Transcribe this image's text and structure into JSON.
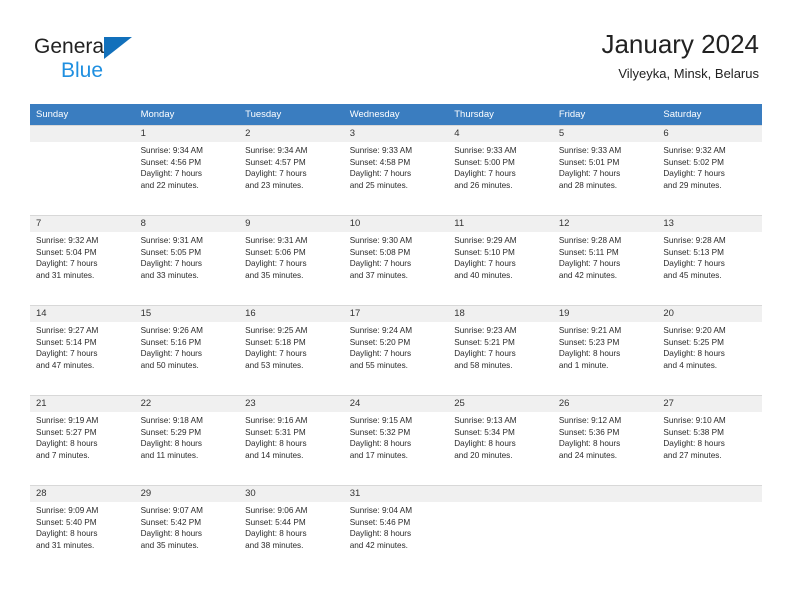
{
  "brand": {
    "name_part1": "General",
    "name_part2": "Blue",
    "triangle_icon": "triangle-logo-icon",
    "accent_dark_blue": "#1270bb",
    "accent_light_blue": "#1f8fe0"
  },
  "header": {
    "title": "January 2024",
    "subtitle": "Vilyeyka, Minsk, Belarus"
  },
  "theme": {
    "header_row_bg": "#3a7dc0",
    "header_row_text": "#ffffff",
    "daynum_bg": "#f0f0f0",
    "cell_border": "#d8d8d8",
    "body_text": "#2b2b2b"
  },
  "weekday_headers": [
    "Sunday",
    "Monday",
    "Tuesday",
    "Wednesday",
    "Thursday",
    "Friday",
    "Saturday"
  ],
  "weeks": [
    [
      {
        "day": "",
        "empty": true,
        "sunrise": "",
        "sunset": "",
        "daylight_line1": "",
        "daylight_line2": ""
      },
      {
        "day": "1",
        "empty": false,
        "sunrise": "Sunrise: 9:34 AM",
        "sunset": "Sunset: 4:56 PM",
        "daylight_line1": "Daylight: 7 hours",
        "daylight_line2": "and 22 minutes."
      },
      {
        "day": "2",
        "empty": false,
        "sunrise": "Sunrise: 9:34 AM",
        "sunset": "Sunset: 4:57 PM",
        "daylight_line1": "Daylight: 7 hours",
        "daylight_line2": "and 23 minutes."
      },
      {
        "day": "3",
        "empty": false,
        "sunrise": "Sunrise: 9:33 AM",
        "sunset": "Sunset: 4:58 PM",
        "daylight_line1": "Daylight: 7 hours",
        "daylight_line2": "and 25 minutes."
      },
      {
        "day": "4",
        "empty": false,
        "sunrise": "Sunrise: 9:33 AM",
        "sunset": "Sunset: 5:00 PM",
        "daylight_line1": "Daylight: 7 hours",
        "daylight_line2": "and 26 minutes."
      },
      {
        "day": "5",
        "empty": false,
        "sunrise": "Sunrise: 9:33 AM",
        "sunset": "Sunset: 5:01 PM",
        "daylight_line1": "Daylight: 7 hours",
        "daylight_line2": "and 28 minutes."
      },
      {
        "day": "6",
        "empty": false,
        "sunrise": "Sunrise: 9:32 AM",
        "sunset": "Sunset: 5:02 PM",
        "daylight_line1": "Daylight: 7 hours",
        "daylight_line2": "and 29 minutes."
      }
    ],
    [
      {
        "day": "7",
        "empty": false,
        "sunrise": "Sunrise: 9:32 AM",
        "sunset": "Sunset: 5:04 PM",
        "daylight_line1": "Daylight: 7 hours",
        "daylight_line2": "and 31 minutes."
      },
      {
        "day": "8",
        "empty": false,
        "sunrise": "Sunrise: 9:31 AM",
        "sunset": "Sunset: 5:05 PM",
        "daylight_line1": "Daylight: 7 hours",
        "daylight_line2": "and 33 minutes."
      },
      {
        "day": "9",
        "empty": false,
        "sunrise": "Sunrise: 9:31 AM",
        "sunset": "Sunset: 5:06 PM",
        "daylight_line1": "Daylight: 7 hours",
        "daylight_line2": "and 35 minutes."
      },
      {
        "day": "10",
        "empty": false,
        "sunrise": "Sunrise: 9:30 AM",
        "sunset": "Sunset: 5:08 PM",
        "daylight_line1": "Daylight: 7 hours",
        "daylight_line2": "and 37 minutes."
      },
      {
        "day": "11",
        "empty": false,
        "sunrise": "Sunrise: 9:29 AM",
        "sunset": "Sunset: 5:10 PM",
        "daylight_line1": "Daylight: 7 hours",
        "daylight_line2": "and 40 minutes."
      },
      {
        "day": "12",
        "empty": false,
        "sunrise": "Sunrise: 9:28 AM",
        "sunset": "Sunset: 5:11 PM",
        "daylight_line1": "Daylight: 7 hours",
        "daylight_line2": "and 42 minutes."
      },
      {
        "day": "13",
        "empty": false,
        "sunrise": "Sunrise: 9:28 AM",
        "sunset": "Sunset: 5:13 PM",
        "daylight_line1": "Daylight: 7 hours",
        "daylight_line2": "and 45 minutes."
      }
    ],
    [
      {
        "day": "14",
        "empty": false,
        "sunrise": "Sunrise: 9:27 AM",
        "sunset": "Sunset: 5:14 PM",
        "daylight_line1": "Daylight: 7 hours",
        "daylight_line2": "and 47 minutes."
      },
      {
        "day": "15",
        "empty": false,
        "sunrise": "Sunrise: 9:26 AM",
        "sunset": "Sunset: 5:16 PM",
        "daylight_line1": "Daylight: 7 hours",
        "daylight_line2": "and 50 minutes."
      },
      {
        "day": "16",
        "empty": false,
        "sunrise": "Sunrise: 9:25 AM",
        "sunset": "Sunset: 5:18 PM",
        "daylight_line1": "Daylight: 7 hours",
        "daylight_line2": "and 53 minutes."
      },
      {
        "day": "17",
        "empty": false,
        "sunrise": "Sunrise: 9:24 AM",
        "sunset": "Sunset: 5:20 PM",
        "daylight_line1": "Daylight: 7 hours",
        "daylight_line2": "and 55 minutes."
      },
      {
        "day": "18",
        "empty": false,
        "sunrise": "Sunrise: 9:23 AM",
        "sunset": "Sunset: 5:21 PM",
        "daylight_line1": "Daylight: 7 hours",
        "daylight_line2": "and 58 minutes."
      },
      {
        "day": "19",
        "empty": false,
        "sunrise": "Sunrise: 9:21 AM",
        "sunset": "Sunset: 5:23 PM",
        "daylight_line1": "Daylight: 8 hours",
        "daylight_line2": "and 1 minute."
      },
      {
        "day": "20",
        "empty": false,
        "sunrise": "Sunrise: 9:20 AM",
        "sunset": "Sunset: 5:25 PM",
        "daylight_line1": "Daylight: 8 hours",
        "daylight_line2": "and 4 minutes."
      }
    ],
    [
      {
        "day": "21",
        "empty": false,
        "sunrise": "Sunrise: 9:19 AM",
        "sunset": "Sunset: 5:27 PM",
        "daylight_line1": "Daylight: 8 hours",
        "daylight_line2": "and 7 minutes."
      },
      {
        "day": "22",
        "empty": false,
        "sunrise": "Sunrise: 9:18 AM",
        "sunset": "Sunset: 5:29 PM",
        "daylight_line1": "Daylight: 8 hours",
        "daylight_line2": "and 11 minutes."
      },
      {
        "day": "23",
        "empty": false,
        "sunrise": "Sunrise: 9:16 AM",
        "sunset": "Sunset: 5:31 PM",
        "daylight_line1": "Daylight: 8 hours",
        "daylight_line2": "and 14 minutes."
      },
      {
        "day": "24",
        "empty": false,
        "sunrise": "Sunrise: 9:15 AM",
        "sunset": "Sunset: 5:32 PM",
        "daylight_line1": "Daylight: 8 hours",
        "daylight_line2": "and 17 minutes."
      },
      {
        "day": "25",
        "empty": false,
        "sunrise": "Sunrise: 9:13 AM",
        "sunset": "Sunset: 5:34 PM",
        "daylight_line1": "Daylight: 8 hours",
        "daylight_line2": "and 20 minutes."
      },
      {
        "day": "26",
        "empty": false,
        "sunrise": "Sunrise: 9:12 AM",
        "sunset": "Sunset: 5:36 PM",
        "daylight_line1": "Daylight: 8 hours",
        "daylight_line2": "and 24 minutes."
      },
      {
        "day": "27",
        "empty": false,
        "sunrise": "Sunrise: 9:10 AM",
        "sunset": "Sunset: 5:38 PM",
        "daylight_line1": "Daylight: 8 hours",
        "daylight_line2": "and 27 minutes."
      }
    ],
    [
      {
        "day": "28",
        "empty": false,
        "sunrise": "Sunrise: 9:09 AM",
        "sunset": "Sunset: 5:40 PM",
        "daylight_line1": "Daylight: 8 hours",
        "daylight_line2": "and 31 minutes."
      },
      {
        "day": "29",
        "empty": false,
        "sunrise": "Sunrise: 9:07 AM",
        "sunset": "Sunset: 5:42 PM",
        "daylight_line1": "Daylight: 8 hours",
        "daylight_line2": "and 35 minutes."
      },
      {
        "day": "30",
        "empty": false,
        "sunrise": "Sunrise: 9:06 AM",
        "sunset": "Sunset: 5:44 PM",
        "daylight_line1": "Daylight: 8 hours",
        "daylight_line2": "and 38 minutes."
      },
      {
        "day": "31",
        "empty": false,
        "sunrise": "Sunrise: 9:04 AM",
        "sunset": "Sunset: 5:46 PM",
        "daylight_line1": "Daylight: 8 hours",
        "daylight_line2": "and 42 minutes."
      },
      {
        "day": "",
        "empty": true,
        "sunrise": "",
        "sunset": "",
        "daylight_line1": "",
        "daylight_line2": ""
      },
      {
        "day": "",
        "empty": true,
        "sunrise": "",
        "sunset": "",
        "daylight_line1": "",
        "daylight_line2": ""
      },
      {
        "day": "",
        "empty": true,
        "sunrise": "",
        "sunset": "",
        "daylight_line1": "",
        "daylight_line2": ""
      }
    ]
  ]
}
